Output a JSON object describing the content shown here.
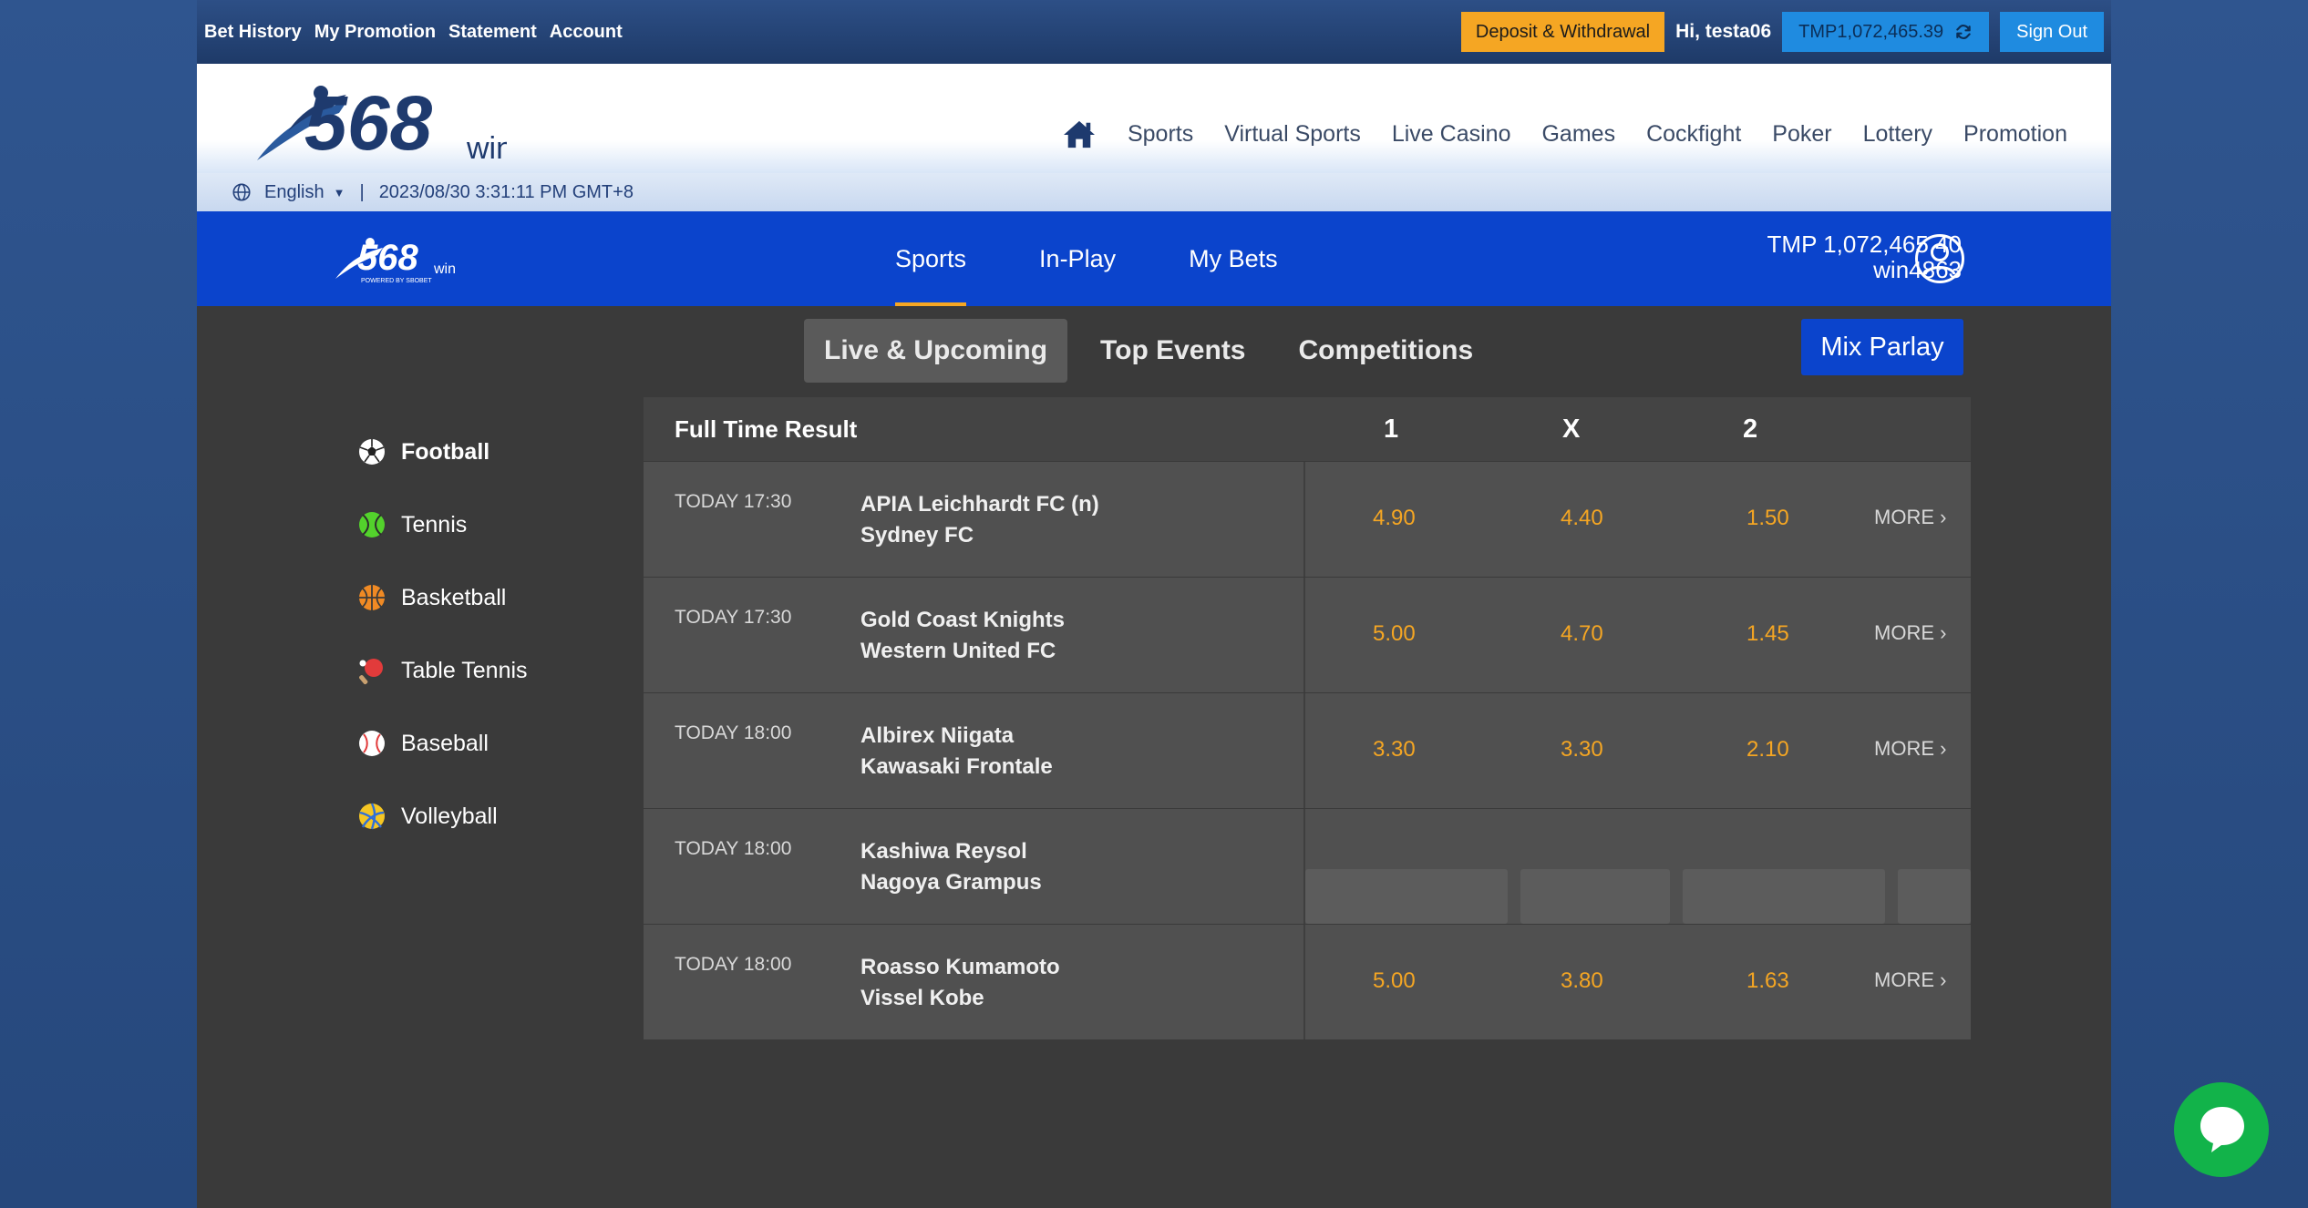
{
  "topbar": {
    "links": [
      "Bet History",
      "My Promotion",
      "Statement",
      "Account"
    ],
    "deposit_label": "Deposit & Withdrawal",
    "greeting": "Hi, testa06",
    "balance": "TMP1,072,465.39",
    "signout_label": "Sign Out"
  },
  "header": {
    "logo_text": "568",
    "logo_suffix": "win",
    "nav": [
      "Sports",
      "Virtual Sports",
      "Live Casino",
      "Games",
      "Cockfight",
      "Poker",
      "Lottery",
      "Promotion"
    ]
  },
  "locale": {
    "language": "English",
    "datetime": "2023/08/30 3:31:11 PM GMT+8"
  },
  "sportsbook": {
    "logo_text": "568",
    "logo_suffix": "win",
    "logo_tagline": "POWERED BY SBOBET",
    "tabs": [
      "Sports",
      "In-Play",
      "My Bets"
    ],
    "balance": "TMP 1,072,465.40",
    "username": "win4863"
  },
  "subtabs": [
    "Live & Upcoming",
    "Top Events",
    "Competitions"
  ],
  "mix_parlay_label": "Mix Parlay",
  "sports": [
    "Football",
    "Tennis",
    "Basketball",
    "Table Tennis",
    "Baseball",
    "Volleyball"
  ],
  "market": {
    "title": "Full Time Result",
    "columns": [
      "1",
      "X",
      "2"
    ],
    "more_label": "MORE",
    "matches": [
      {
        "time": "TODAY 17:30",
        "home": "APIA Leichhardt FC (n)",
        "away": "Sydney FC",
        "odds": [
          "4.90",
          "4.40",
          "1.50"
        ]
      },
      {
        "time": "TODAY 17:30",
        "home": "Gold Coast Knights",
        "away": "Western United FC",
        "odds": [
          "5.00",
          "4.70",
          "1.45"
        ]
      },
      {
        "time": "TODAY 18:00",
        "home": "Albirex Niigata",
        "away": "Kawasaki Frontale",
        "odds": [
          "3.30",
          "3.30",
          "2.10"
        ]
      },
      {
        "time": "TODAY 18:00",
        "home": "Kashiwa Reysol",
        "away": "Nagoya Grampus",
        "odds": []
      },
      {
        "time": "TODAY 18:00",
        "home": "Roasso Kumamoto",
        "away": "Vissel Kobe",
        "odds": [
          "5.00",
          "3.80",
          "1.63"
        ]
      }
    ]
  },
  "colors": {
    "accent": "#f5a623",
    "sportsbook_blue": "#0b44cc",
    "chat_green": "#12b34a"
  }
}
